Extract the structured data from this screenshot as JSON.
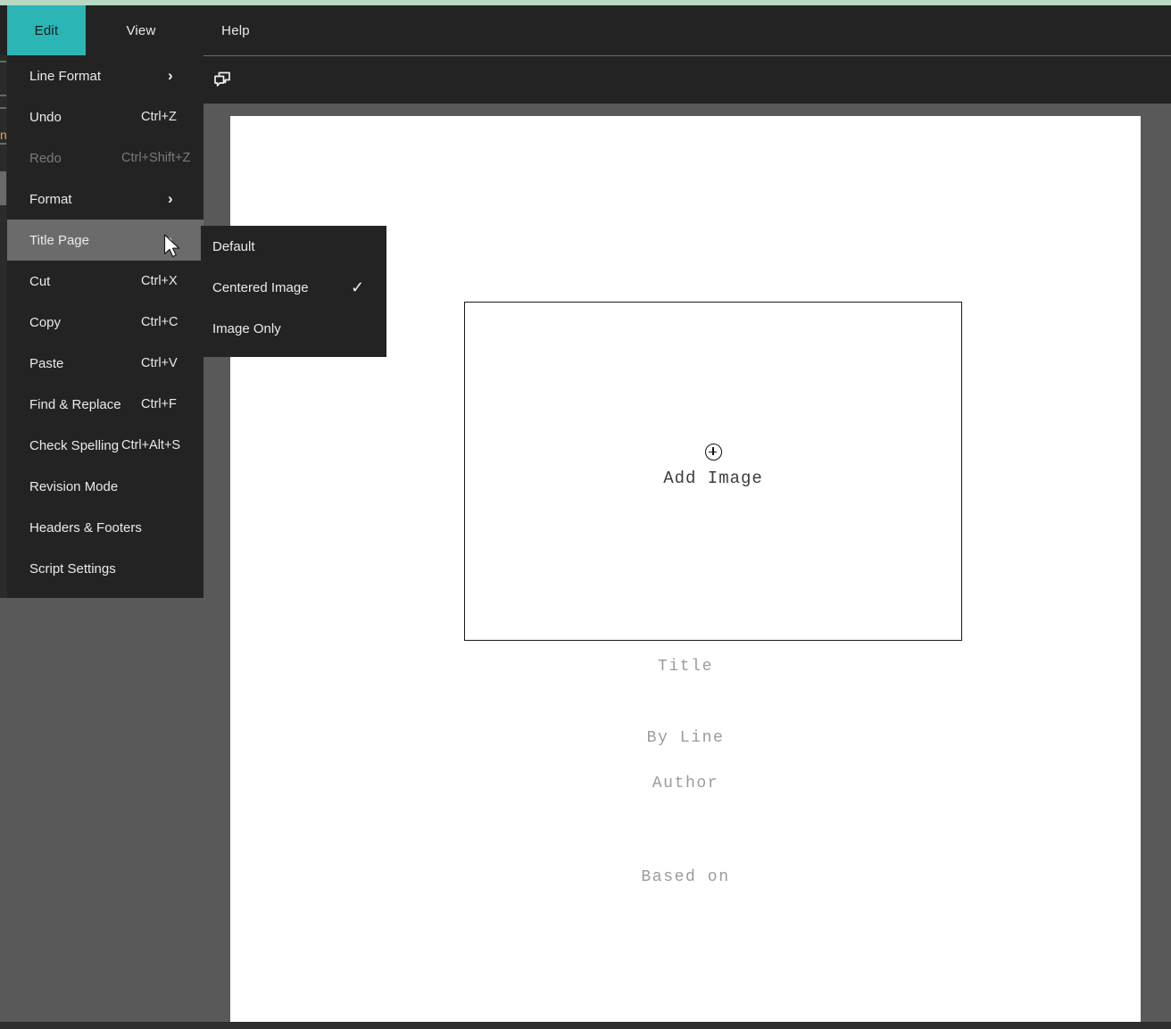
{
  "theme": {
    "accent": "#2bb5b5",
    "top_strip": "#b9d9c2",
    "menu_bg": "#232323",
    "canvas_bg": "#595959",
    "highlight": "#6b6b6b",
    "page_bg": "#ffffff"
  },
  "menubar": {
    "tabs": [
      {
        "label": "Edit",
        "active": true
      },
      {
        "label": "View",
        "active": false
      },
      {
        "label": "Help",
        "active": false
      }
    ]
  },
  "toolbar": {
    "comments_icon": "comments-icon",
    "left_fragment": "n"
  },
  "edit_menu": {
    "items": [
      {
        "label": "Line Format",
        "shortcut": "",
        "submenu": true,
        "disabled": false,
        "highlight": false
      },
      {
        "label": "Undo",
        "shortcut": "Ctrl+Z",
        "submenu": false,
        "disabled": false,
        "highlight": false
      },
      {
        "label": "Redo",
        "shortcut": "Ctrl+Shift+Z",
        "submenu": false,
        "disabled": true,
        "highlight": false
      },
      {
        "label": "Format",
        "shortcut": "",
        "submenu": true,
        "disabled": false,
        "highlight": false
      },
      {
        "label": "Title Page",
        "shortcut": "",
        "submenu": true,
        "disabled": false,
        "highlight": true
      },
      {
        "label": "Cut",
        "shortcut": "Ctrl+X",
        "submenu": false,
        "disabled": false,
        "highlight": false
      },
      {
        "label": "Copy",
        "shortcut": "Ctrl+C",
        "submenu": false,
        "disabled": false,
        "highlight": false
      },
      {
        "label": "Paste",
        "shortcut": "Ctrl+V",
        "submenu": false,
        "disabled": false,
        "highlight": false
      },
      {
        "label": "Find & Replace",
        "shortcut": "Ctrl+F",
        "submenu": false,
        "disabled": false,
        "highlight": false
      },
      {
        "label": "Check Spelling",
        "shortcut": "Ctrl+Alt+S",
        "submenu": false,
        "disabled": false,
        "highlight": false
      },
      {
        "label": "Revision Mode",
        "shortcut": "",
        "submenu": false,
        "disabled": false,
        "highlight": false
      },
      {
        "label": "Headers & Footers",
        "shortcut": "",
        "submenu": false,
        "disabled": false,
        "highlight": false
      },
      {
        "label": "Script Settings",
        "shortcut": "",
        "submenu": false,
        "disabled": false,
        "highlight": false
      }
    ],
    "chevron_glyph": "›"
  },
  "title_page_submenu": {
    "items": [
      {
        "label": "Default",
        "checked": false
      },
      {
        "label": "Centered Image",
        "checked": true
      },
      {
        "label": "Image Only",
        "checked": false
      }
    ],
    "check_glyph": "✓"
  },
  "document": {
    "image_placeholder": {
      "icon": "plus-circle-icon",
      "label": "Add Image"
    },
    "fields": [
      {
        "name": "title",
        "text": "Title"
      },
      {
        "name": "byline",
        "text": "By Line"
      },
      {
        "name": "author",
        "text": "Author"
      },
      {
        "name": "based_on",
        "text": "Based on"
      }
    ]
  }
}
